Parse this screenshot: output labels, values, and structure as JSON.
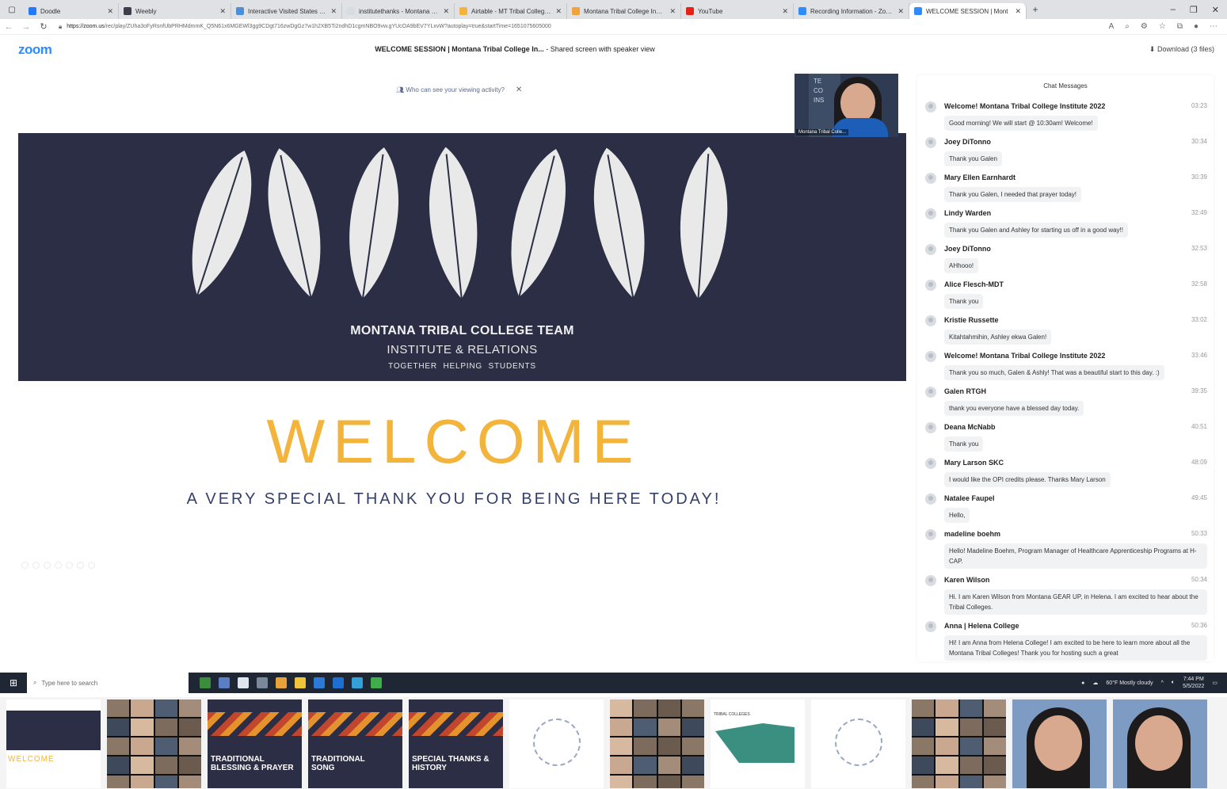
{
  "browser": {
    "tabs": [
      {
        "title": "Doodle",
        "color": "#1f7aff",
        "width": 120
      },
      {
        "title": "Weebly",
        "color": "#3a3f4a",
        "width": 142
      },
      {
        "title": "Interactive Visited States Map",
        "color": "#4a8fd8",
        "width": 140
      },
      {
        "title": "institutethanks - Montana Colle",
        "color": "#d7dbe2",
        "width": 142
      },
      {
        "title": "Airtable - MT Tribal College Inst",
        "color": "#f2b43b",
        "width": 142
      },
      {
        "title": "Montana Tribal College Institute",
        "color": "#f2a23b",
        "width": 144
      },
      {
        "title": "YouTube",
        "color": "#e62117",
        "width": 142
      },
      {
        "title": "Recording Information - Zoom",
        "color": "#2d8cff",
        "width": 146
      },
      {
        "title": "WELCOME SESSION | Mont",
        "color": "#2d8cff",
        "width": 148,
        "active": true
      }
    ],
    "new_tab": "+",
    "url_host": "https://zoom.us",
    "url_path": "/rec/play/ZUha3oFyRsnfUbPRHMdmmK_Q5N61x6MGEWl3gg9CDgt716zwDgGz7w1h2XB5Ti2ndhD1cgmNBO9vw.gYUcOA9bEV7YLxvW?autoplay=true&startTime=1651075605000"
  },
  "zoom": {
    "logo": "zoom",
    "title_bold": "WELCOME SESSION | Montana Tribal College In...",
    "title_rest": " - Shared screen with speaker view",
    "download": "Download (3 files)"
  },
  "share": {
    "viewing_prompt": "Who can see your viewing activity?",
    "team_title": "MONTANA TRIBAL COLLEGE TEAM",
    "team_sub": "INSTITUTE & RELATIONS",
    "team_tag": "TOGETHER HELPING STUDENTS",
    "welcome": "WELCOME",
    "thankyou": "A VERY SPECIAL THANK YOU FOR BEING HERE TODAY!"
  },
  "speaker": {
    "bg_text": "TE\nCO\nINS",
    "name": "Montana Tribal Colle..."
  },
  "chat": {
    "header": "Chat Messages",
    "messages": [
      {
        "sender": "Welcome! Montana Tribal College Institute 2022",
        "time": "03:23",
        "text": "Good morning! We will start @ 10:30am! Welcome!"
      },
      {
        "sender": "Joey DiTonno",
        "time": "30:34",
        "text": "Thank you Galen"
      },
      {
        "sender": "Mary Ellen Earnhardt",
        "time": "30:39",
        "text": "Thank you Galen, I needed that prayer today!"
      },
      {
        "sender": "Lindy Warden",
        "time": "32:49",
        "text": "Thank you Galen and Ashley for starting us off in a good way!!"
      },
      {
        "sender": "Joey DiTonno",
        "time": "32:53",
        "text": "AHhooo!"
      },
      {
        "sender": "Alice Flesch-MDT",
        "time": "32:58",
        "text": "Thank you"
      },
      {
        "sender": "Kristie Russette",
        "time": "33:02",
        "text": "Kitahtahmihin, Ashley ekwa Galen!"
      },
      {
        "sender": "Welcome! Montana Tribal College Institute 2022",
        "time": "33:46",
        "text": "Thank you so much, Galen & Ashly! That was a beautiful start to this day. :)"
      },
      {
        "sender": "Galen RTGH",
        "time": "39:35",
        "text": "thank you everyone have a blessed day today."
      },
      {
        "sender": "Deana McNabb",
        "time": "40:51",
        "text": "Thank you"
      },
      {
        "sender": "Mary Larson SKC",
        "time": "48:09",
        "text": "I would like the OPI credits please. Thanks Mary Larson"
      },
      {
        "sender": "Natalee Faupel",
        "time": "49:45",
        "text": "Hello,"
      },
      {
        "sender": "madeline boehm",
        "time": "50:33",
        "text": "Hello! Madeline Boehm, Program Manager of Healthcare Apprenticeship Programs at H-CAP."
      },
      {
        "sender": "Karen Wilson",
        "time": "50:34",
        "text": "Hi. I am Karen Wilson from Montana GEAR UP, in Helena. I am excited to hear about the Tribal Colleges."
      },
      {
        "sender": "Anna | Helena College",
        "time": "50:36",
        "text": "Hi! I am Anna from Helena College! I am excited to be here to learn more about all the Montana Tribal Colleges! Thank you for hosting such a great"
      }
    ]
  },
  "taskbar": {
    "search_placeholder": "Type here to search",
    "weather": "60°F  Mostly cloudy",
    "time": "7:44 PM",
    "date": "5/5/2022"
  },
  "thumbnails": [
    {
      "kind": "welcome",
      "label": "WELCOME"
    },
    {
      "kind": "grid",
      "label": ""
    },
    {
      "kind": "pattern",
      "label": "TRADITIONAL\nBLESSING & PRAYER"
    },
    {
      "kind": "pattern",
      "label": "TRADITIONAL\nSONG"
    },
    {
      "kind": "pattern",
      "label": "SPECIAL THANKS &\nHISTORY"
    },
    {
      "kind": "slide",
      "label": ""
    },
    {
      "kind": "grid",
      "label": ""
    },
    {
      "kind": "map",
      "label": "TRIBAL COLLEGES"
    },
    {
      "kind": "slide",
      "label": ""
    },
    {
      "kind": "grid",
      "label": ""
    },
    {
      "kind": "face",
      "label": ""
    },
    {
      "kind": "face",
      "label": ""
    }
  ]
}
